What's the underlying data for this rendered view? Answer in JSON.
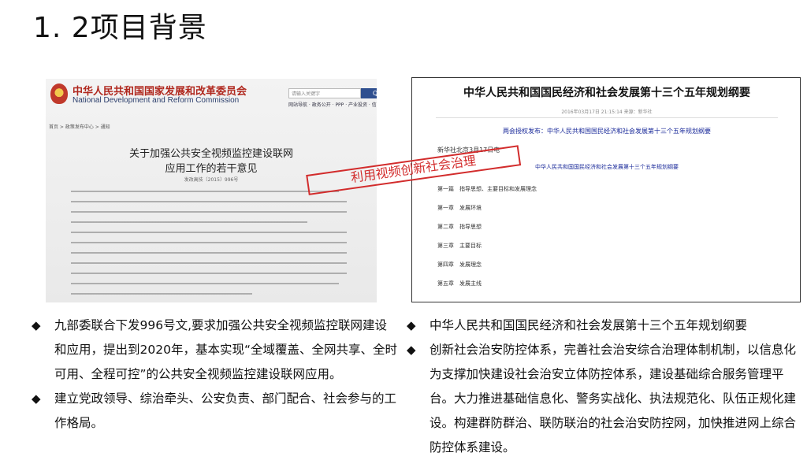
{
  "page": {
    "title": "1. 2项目背景"
  },
  "ndrc": {
    "name_cn": "中华人民共和国国家发展和改革委员会",
    "name_en": "National Development and Reform Commission",
    "search_placeholder": "请输入关键字",
    "search_button": "Q",
    "links": "网站导航 · 政务公开 · PPP · 产业投资 · 信息指南 · 目录",
    "breadcrumb": "首页 > 政策发布中心 > 通知",
    "doc_title_line1": "关于加强公共安全视频监控建设联网",
    "doc_title_line2": "应用工作的若干意见",
    "doc_number": "发改高技〔2015〕996号"
  },
  "plan": {
    "title": "中华人民共和国国民经济和社会发展第十三个五年规划纲要",
    "meta": "2016年03月17日 21:15:14 来源：新华社",
    "link1": "两会授权发布：中华人民共和国国民经济和社会发展第十三个五年规划纲要",
    "dateline": "新华社北京3月17日电",
    "link2": "中华人民共和国国民经济和社会发展第十三个五年规划纲要",
    "chapters": [
      "第一篇　指导思想、主要目标和发展理念",
      "第一章　发展环境",
      "第二章　指导思想",
      "第三章　主要目标",
      "第四章　发展理念",
      "第五章　发展主线"
    ]
  },
  "stamp": {
    "text": "利用视频创新社会治理"
  },
  "bullets_left": [
    "九部委联合下发996号文,要求加强公共安全视频监控联网建设和应用，提出到2020年，基本实现“全域覆盖、全网共享、全时可用、全程可控”的公共安全视频监控建设联网应用。",
    "建立党政领导、综治牵头、公安负责、部门配合、社会参与的工作格局。"
  ],
  "bullets_right": [
    "中华人民共和国国民经济和社会发展第十三个五年规划纲要",
    "创新社会治安防控体系，完善社会治安综合治理体制机制，以信息化为支撑加快建设社会治安立体防控体系，建设基础综合服务管理平台。大力推进基础信息化、警务实战化、执法规范化、队伍正规化建设。构建群防群治、联防联治的社会治安防控网，加快推进网上综合防控体系建设。"
  ],
  "bullet_symbol": "◆",
  "colors": {
    "stamp": "#d22c2c",
    "ndrc_red": "#b0281e",
    "link_blue": "#1a2a9a"
  }
}
